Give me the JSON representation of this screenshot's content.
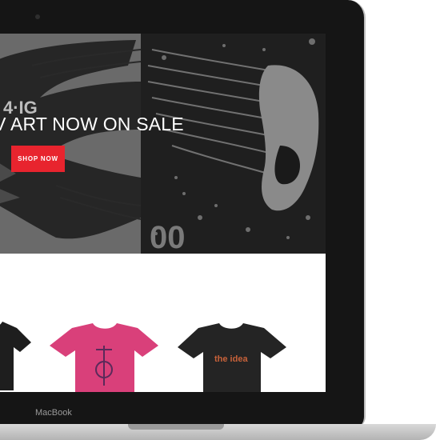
{
  "device": {
    "brand_label": "MacBook"
  },
  "hero": {
    "title": "GV ART NOW ON SALE",
    "cta_label": "SHOP NOW",
    "left_artwork_text": "4·IG",
    "right_artwork_text": "00"
  },
  "products": [
    {
      "name": "black tee",
      "color": "#1e1e1e"
    },
    {
      "name": "pink tee",
      "color": "#d9407a"
    },
    {
      "name": "black tee with logo",
      "color": "#242424",
      "print_text": "the idea"
    }
  ],
  "colors": {
    "accent": "#e8242e"
  }
}
